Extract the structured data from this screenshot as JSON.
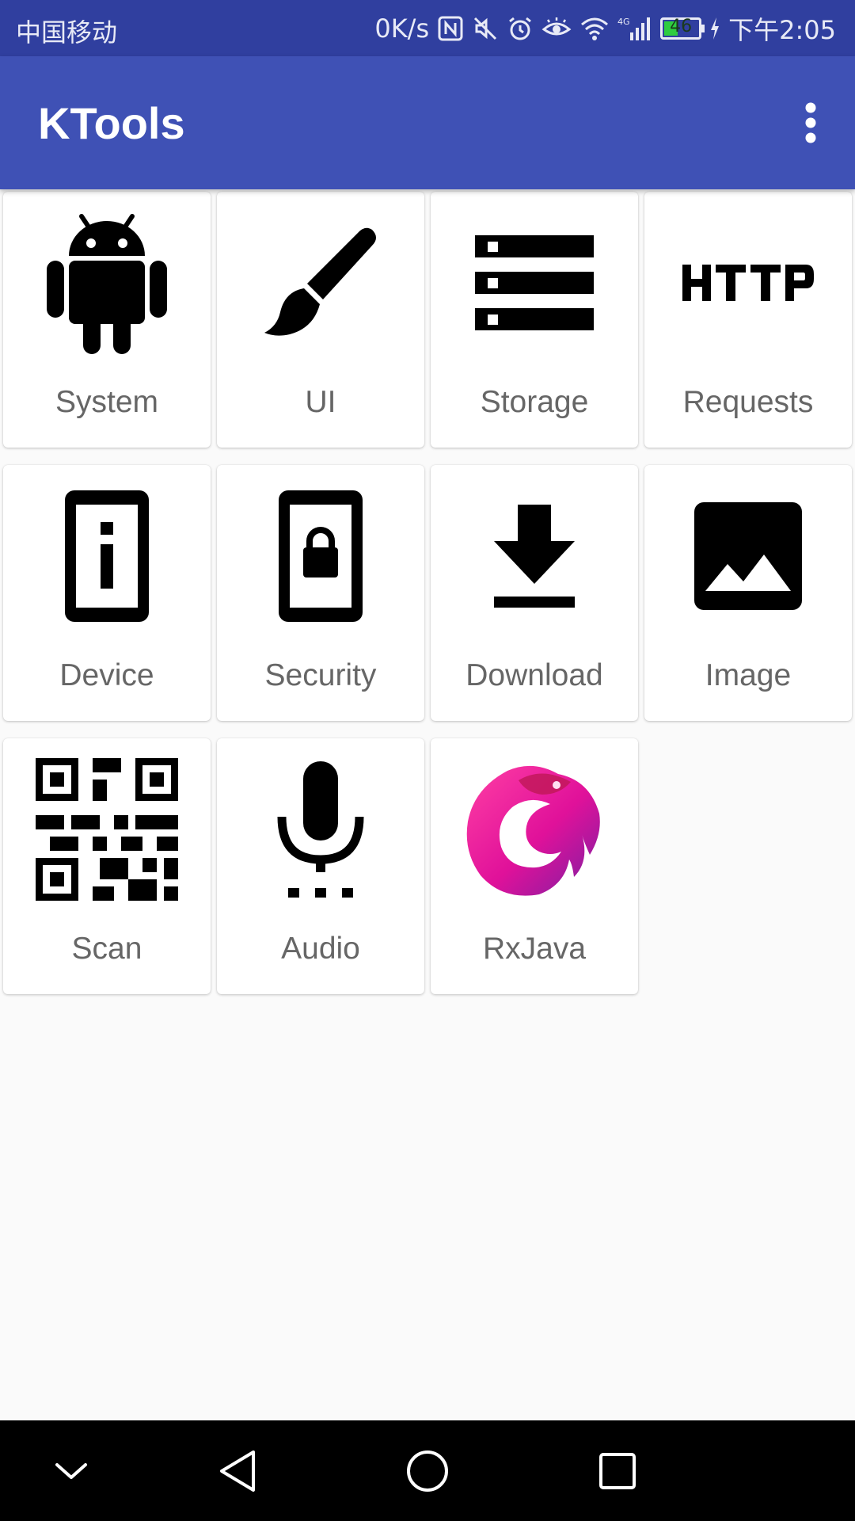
{
  "status_bar": {
    "carrier": "中国移动",
    "speed": "0K/s",
    "network_type": "4G",
    "battery_level": 46,
    "battery_text": "46",
    "time": "下午2:05",
    "icons": [
      "nfc-icon",
      "mute-icon",
      "alarm-icon",
      "eye-comfort-icon",
      "wifi-icon",
      "signal-icon",
      "battery-icon",
      "charging-icon"
    ]
  },
  "toolbar": {
    "title": "KTools",
    "overflow_icon": "more-vert-icon"
  },
  "colors": {
    "status_bar": "#303f9f",
    "toolbar": "#3f51b5",
    "background": "#fafafa",
    "card": "#ffffff",
    "label": "#666666",
    "navbar": "#000000"
  },
  "tools": [
    {
      "label": "System",
      "icon": "android-icon"
    },
    {
      "label": "UI",
      "icon": "brush-icon"
    },
    {
      "label": "Storage",
      "icon": "storage-icon"
    },
    {
      "label": "Requests",
      "icon": "http-icon"
    },
    {
      "label": "Device",
      "icon": "device-info-icon"
    },
    {
      "label": "Security",
      "icon": "phone-lock-icon"
    },
    {
      "label": "Download",
      "icon": "download-icon"
    },
    {
      "label": "Image",
      "icon": "image-icon"
    },
    {
      "label": "Scan",
      "icon": "qr-code-icon"
    },
    {
      "label": "Audio",
      "icon": "microphone-icon"
    },
    {
      "label": "RxJava",
      "icon": "rxjava-logo-icon"
    }
  ],
  "nav_bar": {
    "icons": [
      "hide-nav-icon",
      "back-icon",
      "home-icon",
      "recents-icon"
    ]
  }
}
